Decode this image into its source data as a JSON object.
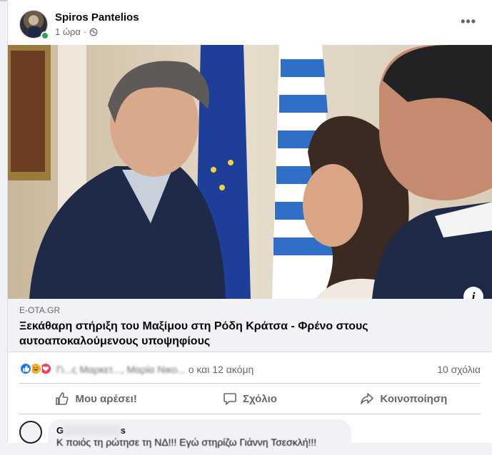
{
  "post": {
    "author": "Spiros Pantelios",
    "time": "1 ώρα",
    "time_separator": "·",
    "more": "•••"
  },
  "link": {
    "domain": "E-OTA.GR",
    "title": "Ξεκάθαρη στήριξη του Μαξίμου στη Ρόδη Κράτσα - Φρένο στους αυτοαποκαλούμενους υποψηφίους",
    "info": "i"
  },
  "reactions": {
    "reactors_blurred": "Γι...ς Μαρκετ..., Μαρία Νικο...",
    "reactors_suffix": "ο και 12 ακόμη",
    "comments_count": "10 σχόλια"
  },
  "actions": {
    "like": "Μου αρέσει!",
    "comment": "Σχόλιο",
    "share": "Κοινοποίηση"
  },
  "comment": {
    "name_blurred": "G",
    "name_suffix": "s",
    "text": "Κ ποιός τη ρώτησε τη ΝΔ!!! Εγώ στηρίζω Γιάννη Τσεσκλή!!!"
  },
  "colors": {
    "like": "#1877f2",
    "online": "#31a24c",
    "secondary_text": "#65676b"
  }
}
